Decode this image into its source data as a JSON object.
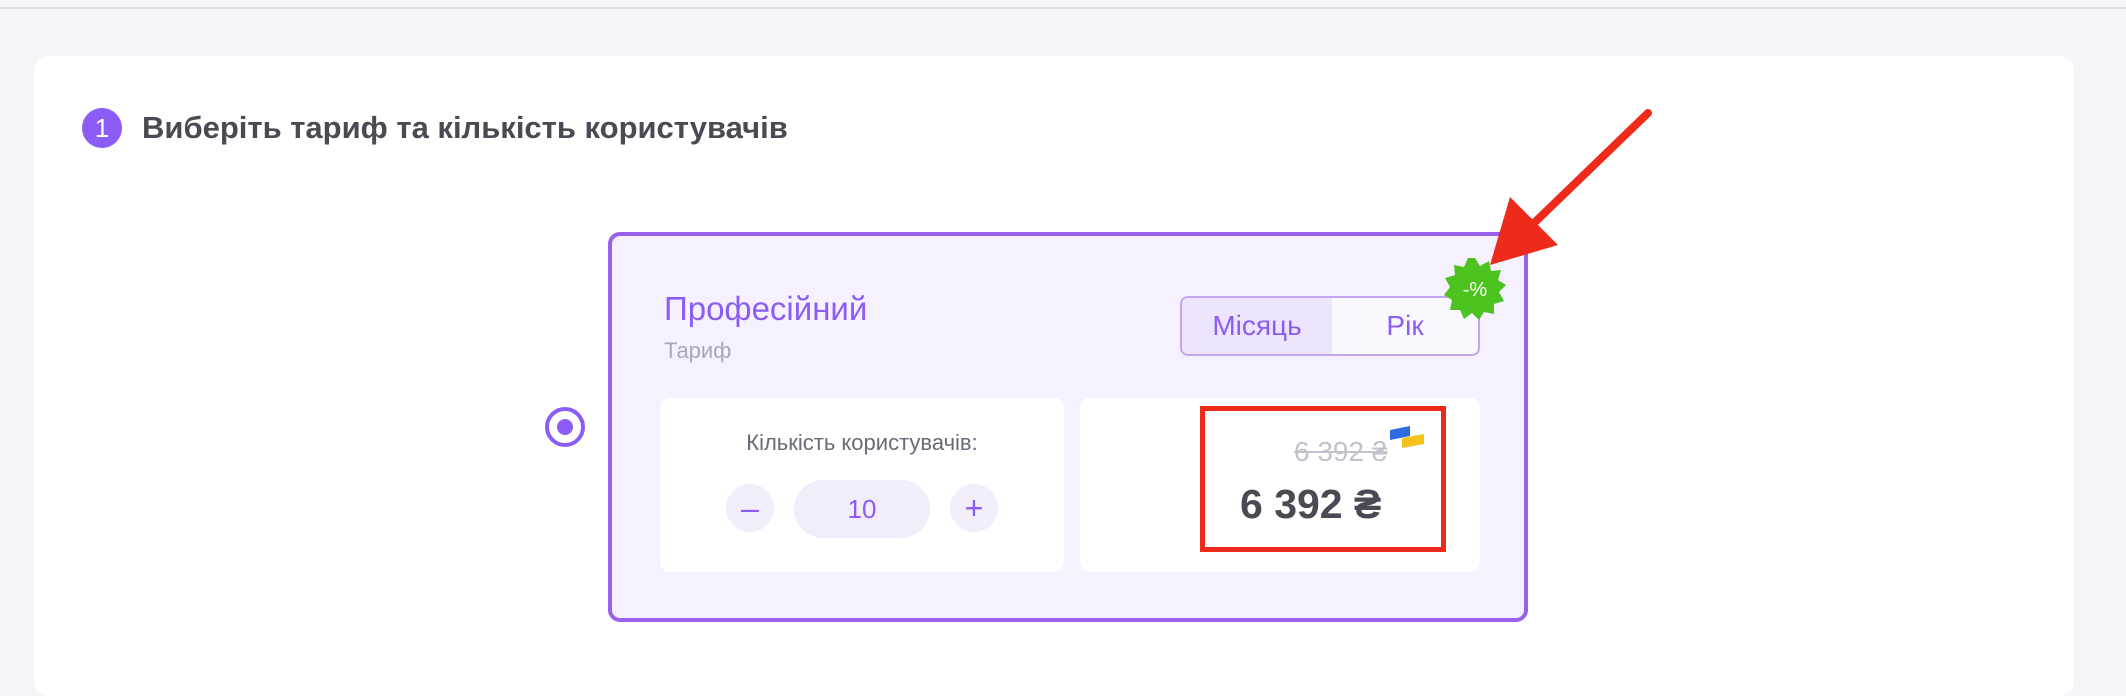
{
  "step": {
    "number": "1",
    "title": "Виберіть тариф та кількість користувачів"
  },
  "plan": {
    "name": "Професійний",
    "subtitle": "Тариф",
    "billing": {
      "month": "Місяць",
      "year": "Рік",
      "selected": "month"
    },
    "discount_badge": "-%",
    "users": {
      "label": "Кількість користувачів:",
      "minus": "–",
      "quantity": "10",
      "plus": "+"
    },
    "price": {
      "old": "6 392 ₴",
      "current": "6 392 ₴"
    }
  },
  "colors": {
    "accent": "#8b5cf6",
    "discount": "#4cc31f",
    "annotation": "#ee2a1a"
  }
}
